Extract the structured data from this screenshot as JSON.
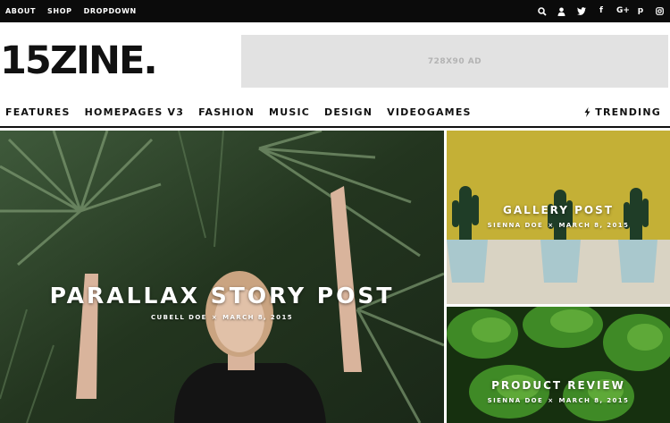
{
  "top_nav": [
    "ABOUT",
    "SHOP",
    "DROPDOWN"
  ],
  "top_icons": [
    "search-icon",
    "user-icon",
    "twitter-icon",
    "facebook-icon",
    "google-plus-icon",
    "pinterest-icon",
    "instagram-icon"
  ],
  "icon_glyphs": {
    "facebook": "f",
    "google_plus": "G+",
    "pinterest": "p"
  },
  "logo": "15ZINE.",
  "ad_text": "728X90 AD",
  "main_nav": [
    "FEATURES",
    "HOMEPAGES V3",
    "FASHION",
    "MUSIC",
    "DESIGN",
    "VIDEOGAMES"
  ],
  "trending": "TRENDING",
  "posts": [
    {
      "title": "PARALLAX STORY POST",
      "author": "CUBELL DOE",
      "date": "MARCH 8, 2015"
    },
    {
      "title": "GALLERY POST",
      "author": "SIENNA DOE",
      "date": "MARCH 8, 2015"
    },
    {
      "title": "PRODUCT REVIEW",
      "author": "SIENNA DOE",
      "date": "MARCH 8, 2015"
    }
  ],
  "meta_separator": "×",
  "colors": {
    "topbar": "#0b0b0b",
    "ad_bg": "#e2e2e2",
    "text": "#111111"
  }
}
